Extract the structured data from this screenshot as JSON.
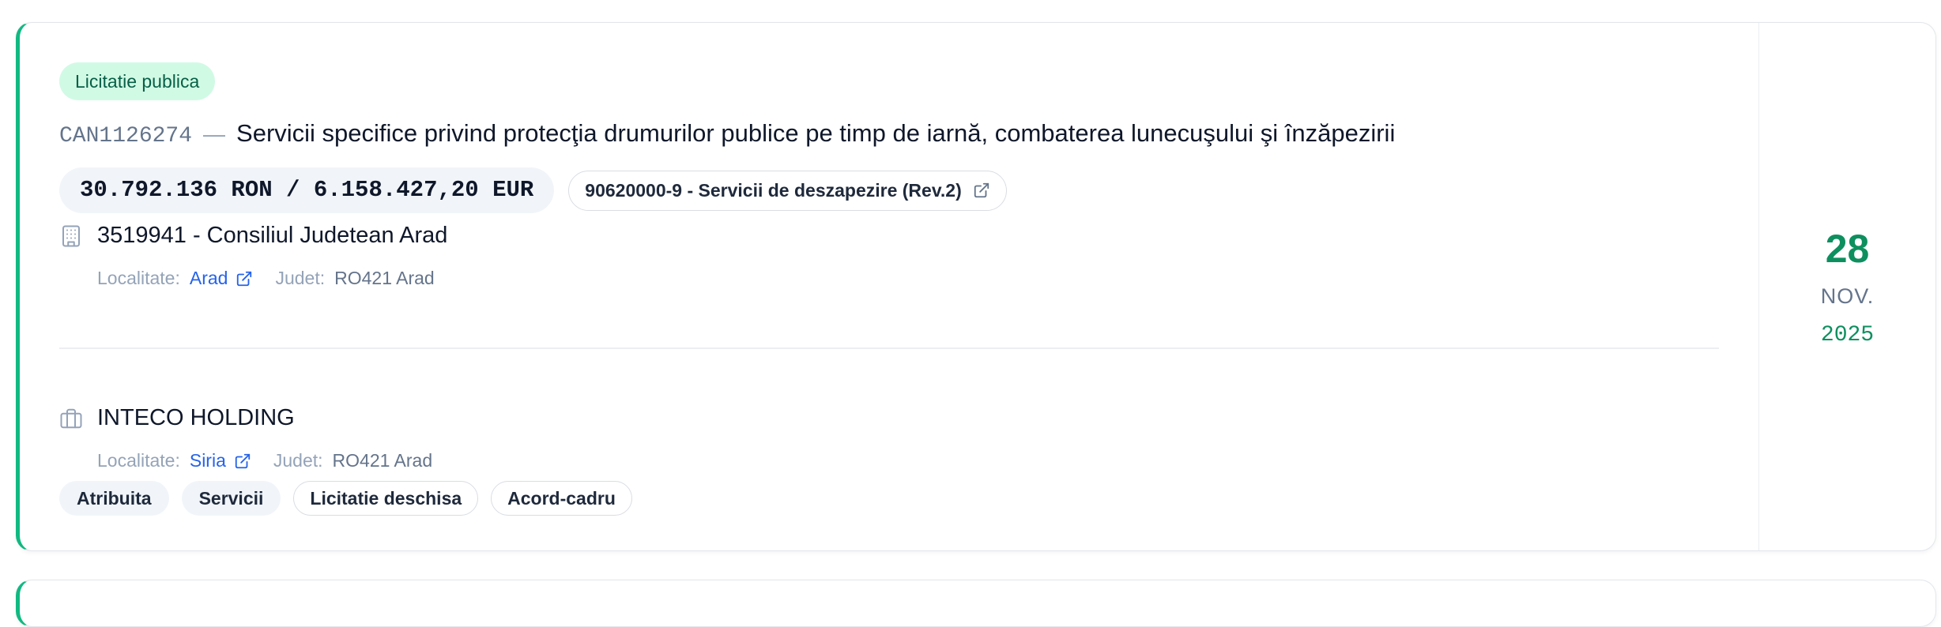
{
  "card": {
    "type_badge": "Licitatie publica",
    "code": "CAN1126274",
    "dash": "—",
    "title": "Servicii specifice privind protecţia drumurilor publice pe timp de iarnă, combaterea lunecuşului şi înzăpezirii",
    "value": "30.792.136 RON / 6.158.427,20 EUR",
    "cpv": "90620000-9 - Servicii de deszapezire (Rev.2)",
    "authority": {
      "name": "3519941 - Consiliul Judetean Arad",
      "locality_label": "Localitate:",
      "locality": "Arad",
      "county_label": "Judet:",
      "county": "RO421 Arad",
      "icon": "building-icon"
    },
    "winner": {
      "name": "INTECO HOLDING",
      "locality_label": "Localitate:",
      "locality": "Siria",
      "county_label": "Judet:",
      "county": "RO421 Arad",
      "icon": "briefcase-icon"
    },
    "tags": [
      "Atribuita",
      "Servicii",
      "Licitatie deschisa",
      "Acord-cadru"
    ],
    "date": {
      "day": "28",
      "month": "NOV.",
      "year": "2025"
    }
  },
  "colors": {
    "accent": "#10b981",
    "date_green": "#0e8f5f",
    "link_blue": "#2563eb",
    "badge_bg": "#d1fae5",
    "badge_text": "#065f46"
  }
}
